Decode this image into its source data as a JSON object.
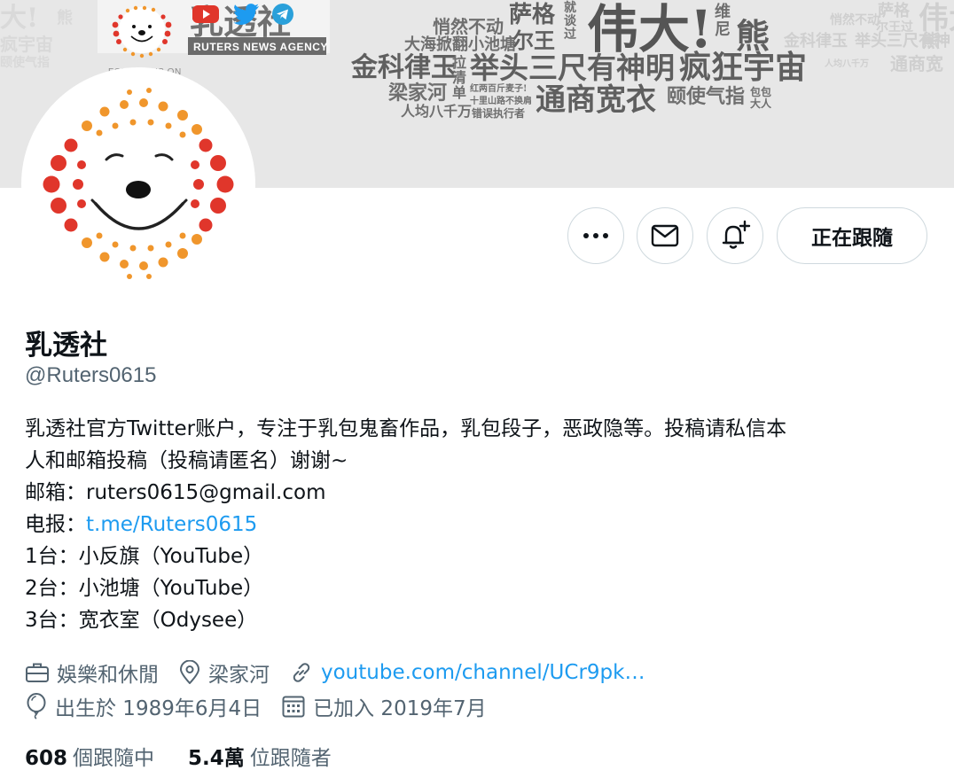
{
  "banner": {
    "agency_name": "乳透社",
    "agency_sub": "RUTERS NEWS AGENCY",
    "follow_text": "FOLLOW US ON",
    "main_text": "伟大!",
    "phrases": {
      "p1": "悄然不动",
      "p2": "萨格",
      "p3": "就谈过",
      "p4": "大海掀翻小池塘",
      "p5": "尔王",
      "p6": "熊",
      "p7": "维尼",
      "p8": "金科律玉",
      "p9": "拉清单",
      "p10": "举头三尺有神明",
      "p11": "疯狂宇宙",
      "p12": "梁家河",
      "p13": "红两百斤麦子!",
      "p14": "十里山路不换肩",
      "p15": "通商宽衣",
      "p16": "颐使气指",
      "p17": "包包大人",
      "p18": "人均八千万",
      "p19": "错误执行者",
      "p20": "萨格",
      "p21": "伟大",
      "p22": "金科律玉",
      "p23": "举头三尺有神",
      "p24": "熊",
      "p25": "通商宽",
      "p26": "大!",
      "p27": "熊",
      "p28": "疯宇宙",
      "p29": "颐使气指",
      "p30": "悄然不动",
      "p31": "尔王过",
      "p32": "人均八千万"
    }
  },
  "actions": {
    "more_label": "More",
    "message_label": "Message",
    "notify_label": "Turn on notifications",
    "follow_label": "正在跟隨"
  },
  "profile": {
    "name": "乳透社",
    "handle": "@Ruters0615",
    "bio": {
      "line1": "乳透社官方Twitter账户，专注于乳包鬼畜作品，乳包段子，恶政隐等。投稿请私信本",
      "line2": "人和邮箱投稿（投稿请匿名）谢谢~",
      "line3": "邮箱：ruters0615@gmail.com",
      "line4_label": "电报：",
      "line4_link": "t.me/Ruters0615",
      "line5": "1台：小反旗（YouTube）",
      "line6": "2台：小池塘（YouTube）",
      "line7": "3台：宽衣室（Odysee）"
    },
    "category": "娛樂和休閒",
    "location": "梁家河",
    "website": "youtube.com/channel/UCr9pk…",
    "birthday": "出生於 1989年6月4日",
    "joined": "已加入 2019年7月"
  },
  "counts": {
    "following_value": "608",
    "following_label": "個跟隨中",
    "followers_value": "5.4萬",
    "followers_label": "位跟隨者"
  },
  "colors": {
    "link": "#1d9bf0",
    "secondary_text": "#536471",
    "border": "#cfd9de",
    "banner_bg": "#e7e7e7",
    "avatar_red": "#e0362b",
    "avatar_orange": "#f0962c"
  },
  "icons": {
    "more": "more-dots-icon",
    "message": "envelope-icon",
    "notify": "bell-plus-icon",
    "category": "briefcase-icon",
    "location": "location-pin-icon",
    "website": "link-icon",
    "birthday": "balloon-icon",
    "joined": "calendar-icon",
    "youtube": "youtube-icon",
    "twitter": "twitter-icon",
    "telegram": "telegram-icon"
  }
}
